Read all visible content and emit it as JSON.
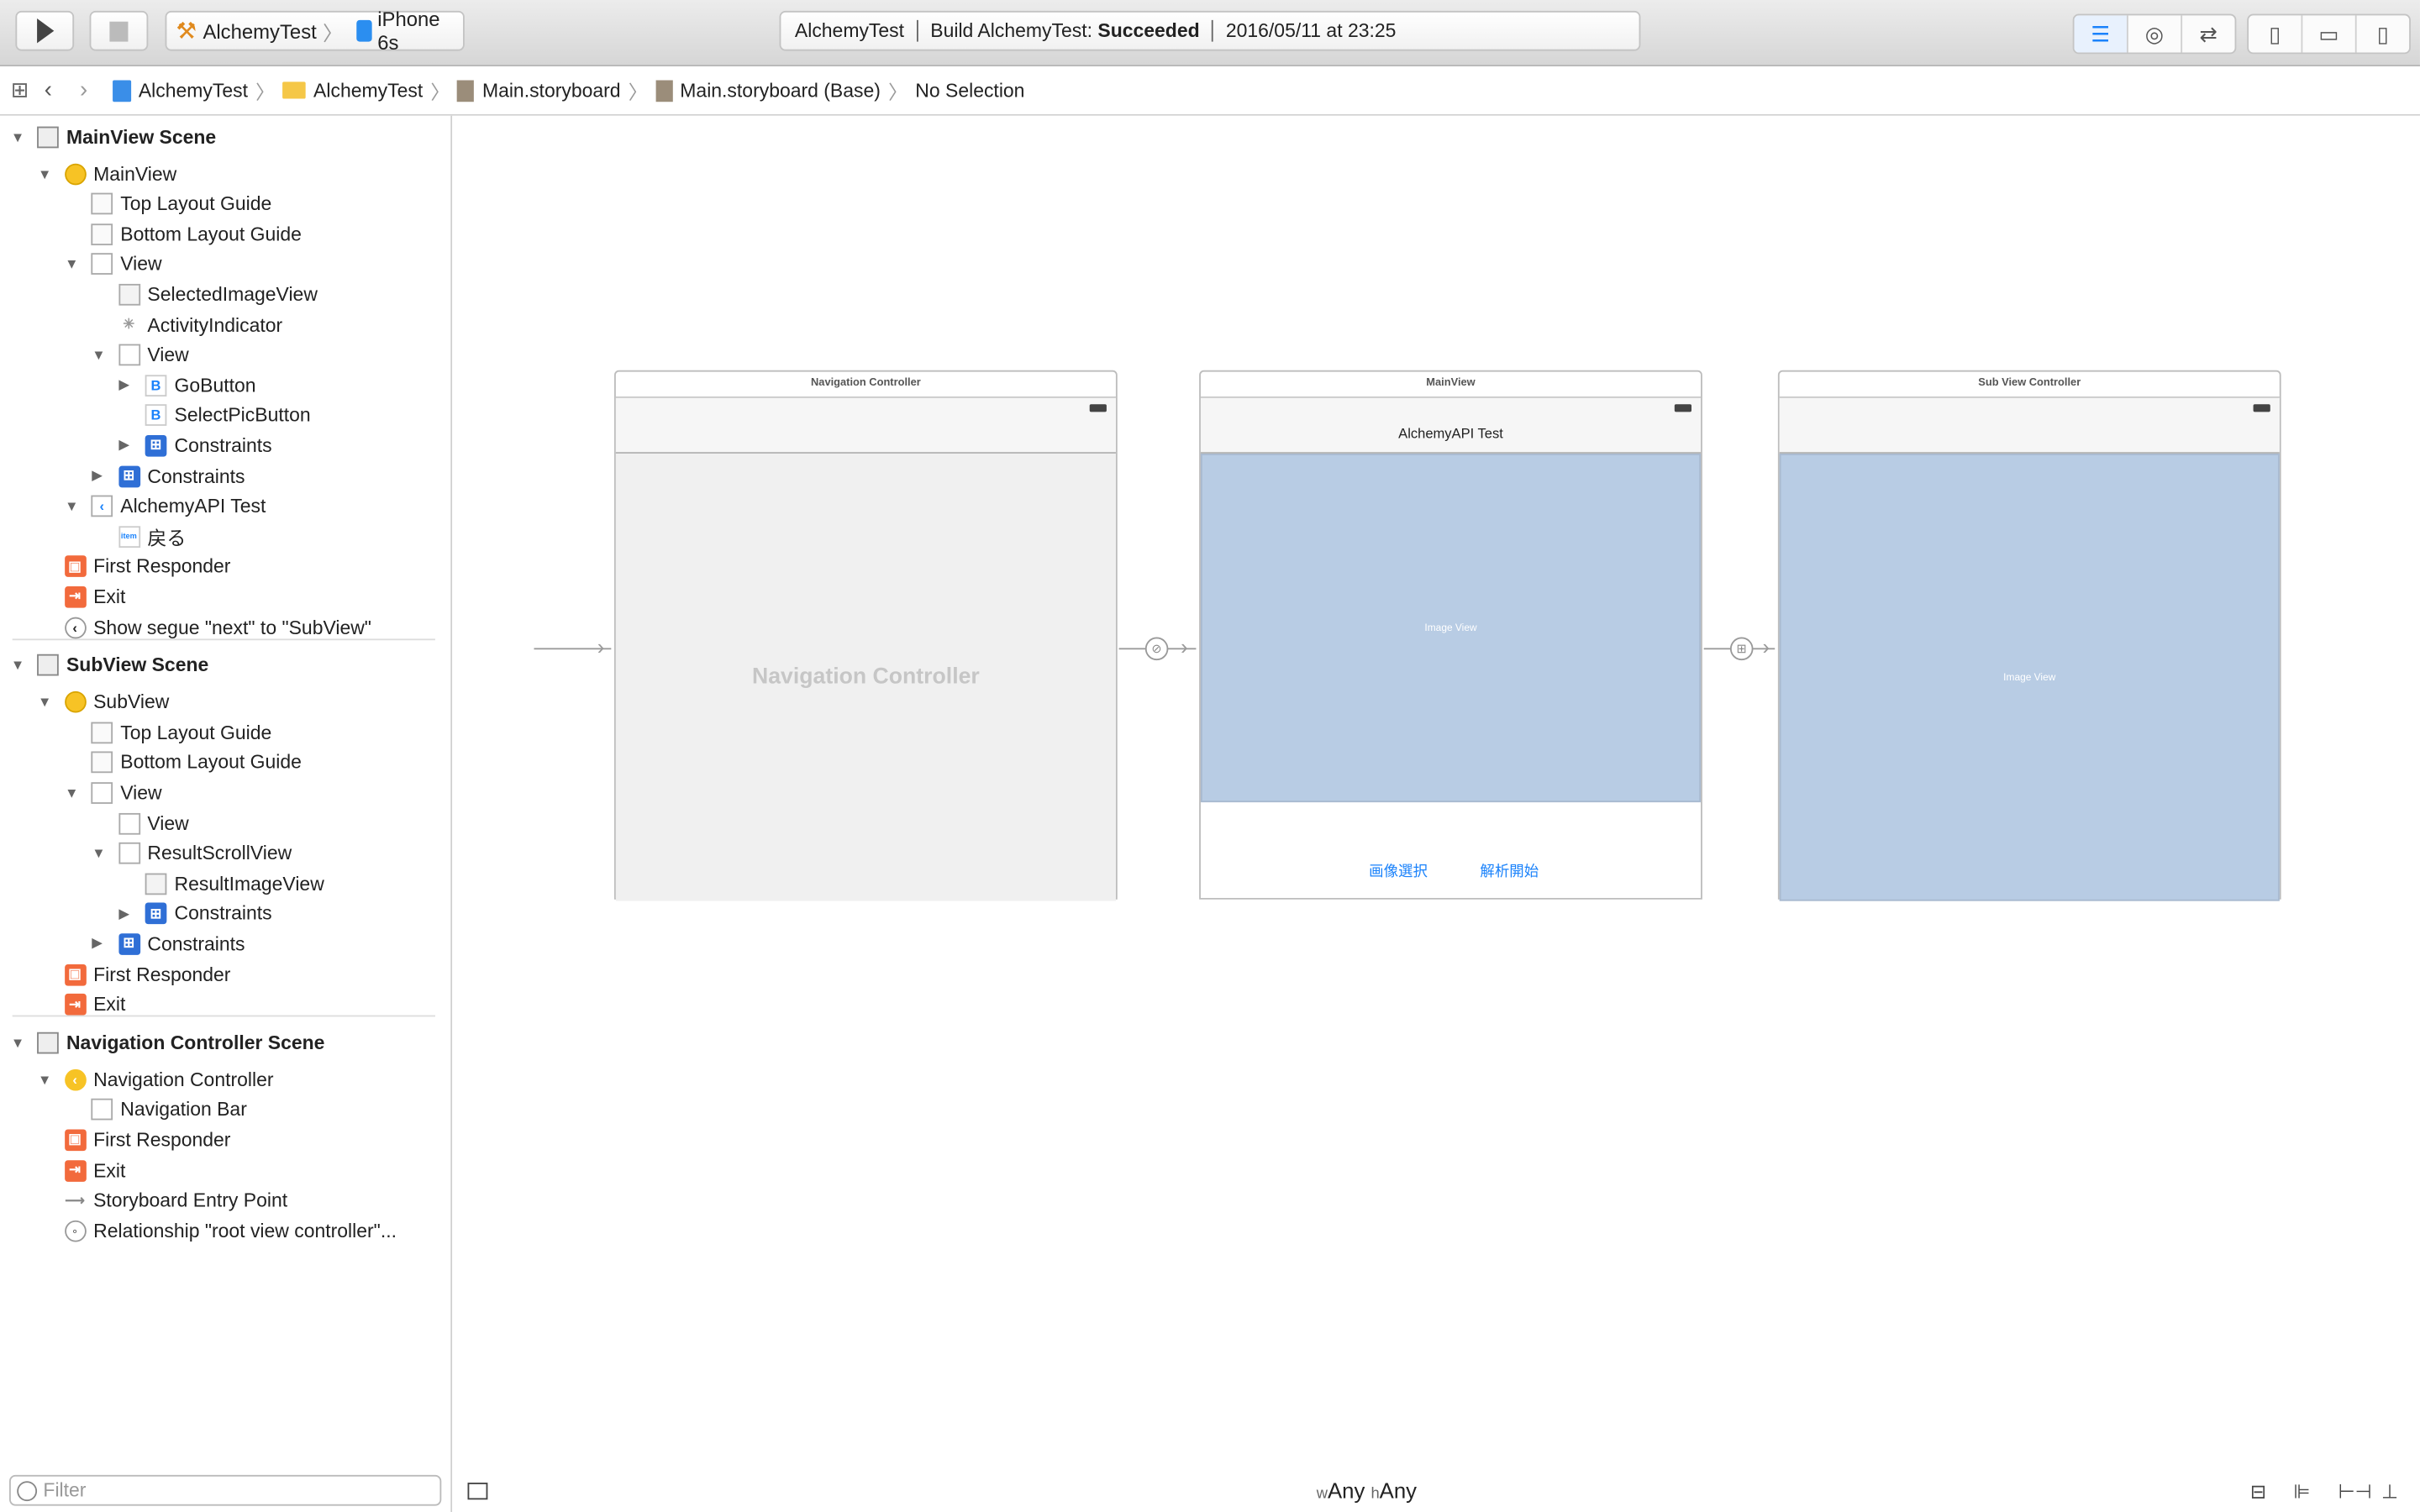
{
  "toolbar": {
    "scheme": "AlchemyTest",
    "device": "iPhone 6s",
    "activity": {
      "project": "AlchemyTest",
      "build_prefix": "Build AlchemyTest:",
      "build_status": "Succeeded",
      "timestamp": "2016/05/11 at 23:25"
    }
  },
  "jumpbar": {
    "crumbs": [
      "AlchemyTest",
      "AlchemyTest",
      "Main.storyboard",
      "Main.storyboard (Base)",
      "No Selection"
    ]
  },
  "outline": {
    "rows": [
      {
        "label": "MainView Scene",
        "level": 0,
        "tri": "down",
        "icon": "scene",
        "scene": true
      },
      {
        "label": "MainView",
        "level": 1,
        "tri": "down",
        "icon": "vc"
      },
      {
        "label": "Top Layout Guide",
        "level": 2,
        "icon": "guide"
      },
      {
        "label": "Bottom Layout Guide",
        "level": 2,
        "icon": "guide"
      },
      {
        "label": "View",
        "level": 2,
        "tri": "down",
        "icon": "view"
      },
      {
        "label": "SelectedImageView",
        "level": 3,
        "icon": "image"
      },
      {
        "label": "ActivityIndicator",
        "level": 3,
        "icon": "spinner"
      },
      {
        "label": "View",
        "level": 3,
        "tri": "down",
        "icon": "view"
      },
      {
        "label": "GoButton",
        "level": 4,
        "tri": "right",
        "icon": "button"
      },
      {
        "label": "SelectPicButton",
        "level": 4,
        "icon": "button"
      },
      {
        "label": "Constraints",
        "level": 4,
        "tri": "right",
        "icon": "constraints"
      },
      {
        "label": "Constraints",
        "level": 3,
        "tri": "right",
        "icon": "constraints"
      },
      {
        "label": "AlchemyAPI Test",
        "level": 2,
        "tri": "down",
        "icon": "navitem"
      },
      {
        "label": "戻る",
        "level": 3,
        "icon": "baritem"
      },
      {
        "label": "First Responder",
        "level": 1,
        "icon": "responder"
      },
      {
        "label": "Exit",
        "level": 1,
        "icon": "exit"
      },
      {
        "label": "Show segue \"next\" to \"SubView\"",
        "level": 1,
        "icon": "segue"
      },
      {
        "label": "SubView Scene",
        "level": 0,
        "tri": "down",
        "icon": "scene",
        "scene": true
      },
      {
        "label": "SubView",
        "level": 1,
        "tri": "down",
        "icon": "vc"
      },
      {
        "label": "Top Layout Guide",
        "level": 2,
        "icon": "guide"
      },
      {
        "label": "Bottom Layout Guide",
        "level": 2,
        "icon": "guide"
      },
      {
        "label": "View",
        "level": 2,
        "tri": "down",
        "icon": "view"
      },
      {
        "label": "View",
        "level": 3,
        "icon": "view"
      },
      {
        "label": "ResultScrollView",
        "level": 3,
        "tri": "down",
        "icon": "view"
      },
      {
        "label": "ResultImageView",
        "level": 4,
        "icon": "image"
      },
      {
        "label": "Constraints",
        "level": 4,
        "tri": "right",
        "icon": "constraints"
      },
      {
        "label": "Constraints",
        "level": 3,
        "tri": "right",
        "icon": "constraints"
      },
      {
        "label": "First Responder",
        "level": 1,
        "icon": "responder"
      },
      {
        "label": "Exit",
        "level": 1,
        "icon": "exit"
      },
      {
        "label": "Navigation Controller Scene",
        "level": 0,
        "tri": "down",
        "icon": "scene",
        "scene": true
      },
      {
        "label": "Navigation Controller",
        "level": 1,
        "tri": "down",
        "icon": "navvc"
      },
      {
        "label": "Navigation Bar",
        "level": 2,
        "icon": "navbar"
      },
      {
        "label": "First Responder",
        "level": 1,
        "icon": "responder"
      },
      {
        "label": "Exit",
        "level": 1,
        "icon": "exit"
      },
      {
        "label": "Storyboard Entry Point",
        "level": 1,
        "icon": "entry"
      },
      {
        "label": "Relationship \"root view controller\"...",
        "level": 1,
        "icon": "relationship"
      }
    ],
    "filter_placeholder": "Filter"
  },
  "canvas": {
    "nav_scene": {
      "title": "Navigation Controller",
      "placeholder": "Navigation Controller"
    },
    "main_scene": {
      "title": "MainView",
      "nav_title": "AlchemyAPI Test",
      "image_label": "Image View",
      "buttons": [
        "画像選択",
        "解析開始"
      ]
    },
    "sub_scene": {
      "title": "Sub View Controller",
      "image_label": "Image View"
    }
  },
  "size_class": {
    "w_prefix": "w",
    "w": "Any",
    "h_prefix": "h",
    "h": "Any"
  },
  "colors": {
    "accent": "#1a82fb",
    "image_view": "#b8cce4",
    "vc_icon": "#f7c325",
    "responder": "#f26a3c"
  }
}
